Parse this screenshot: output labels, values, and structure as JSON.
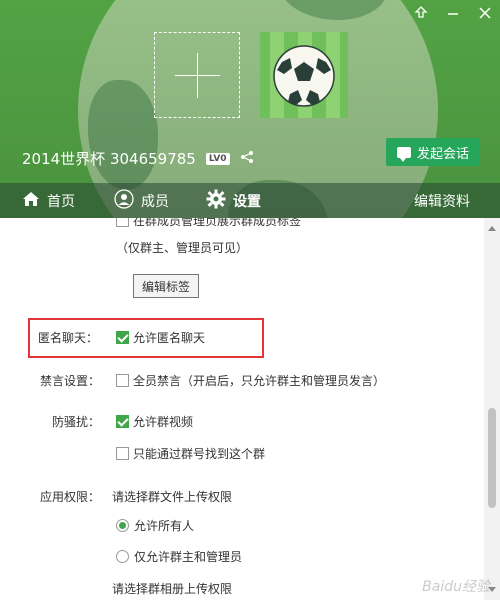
{
  "header": {
    "group_name": "2014世界杯 304659785",
    "level_badge": "LV0",
    "chat_button": "发起会话"
  },
  "nav": {
    "home": "首页",
    "members": "成员",
    "settings": "设置",
    "edit_profile": "编辑资料"
  },
  "settings": {
    "tag_option_partial": "在群成员管理页展示群成员标签",
    "tag_visibility_note": "（仅群主、管理员可见）",
    "edit_tag_button": "编辑标签",
    "anonymous": {
      "label": "匿名聊天：",
      "option": "允许匿名聊天",
      "checked": true
    },
    "mute": {
      "label": "禁言设置：",
      "option": "全员禁言（开启后，只允许群主和管理员发言）",
      "checked": false
    },
    "anti_harass": {
      "label": "防骚扰：",
      "options": [
        {
          "text": "允许群视频",
          "checked": true
        },
        {
          "text": "只能通过群号找到这个群",
          "checked": false
        }
      ]
    },
    "app_permissions": {
      "label": "应用权限：",
      "file_prompt": "请选择群文件上传权限",
      "file_options": [
        {
          "text": "允许所有人",
          "selected": true
        },
        {
          "text": "仅允许群主和管理员",
          "selected": false
        }
      ],
      "album_prompt": "请选择群相册上传权限"
    }
  },
  "watermark": "Baidu经验",
  "colors": {
    "header_green": "#55a546",
    "accent_green": "#3fa64a",
    "chat_button": "#26a65b",
    "highlight_red": "#e23535"
  }
}
